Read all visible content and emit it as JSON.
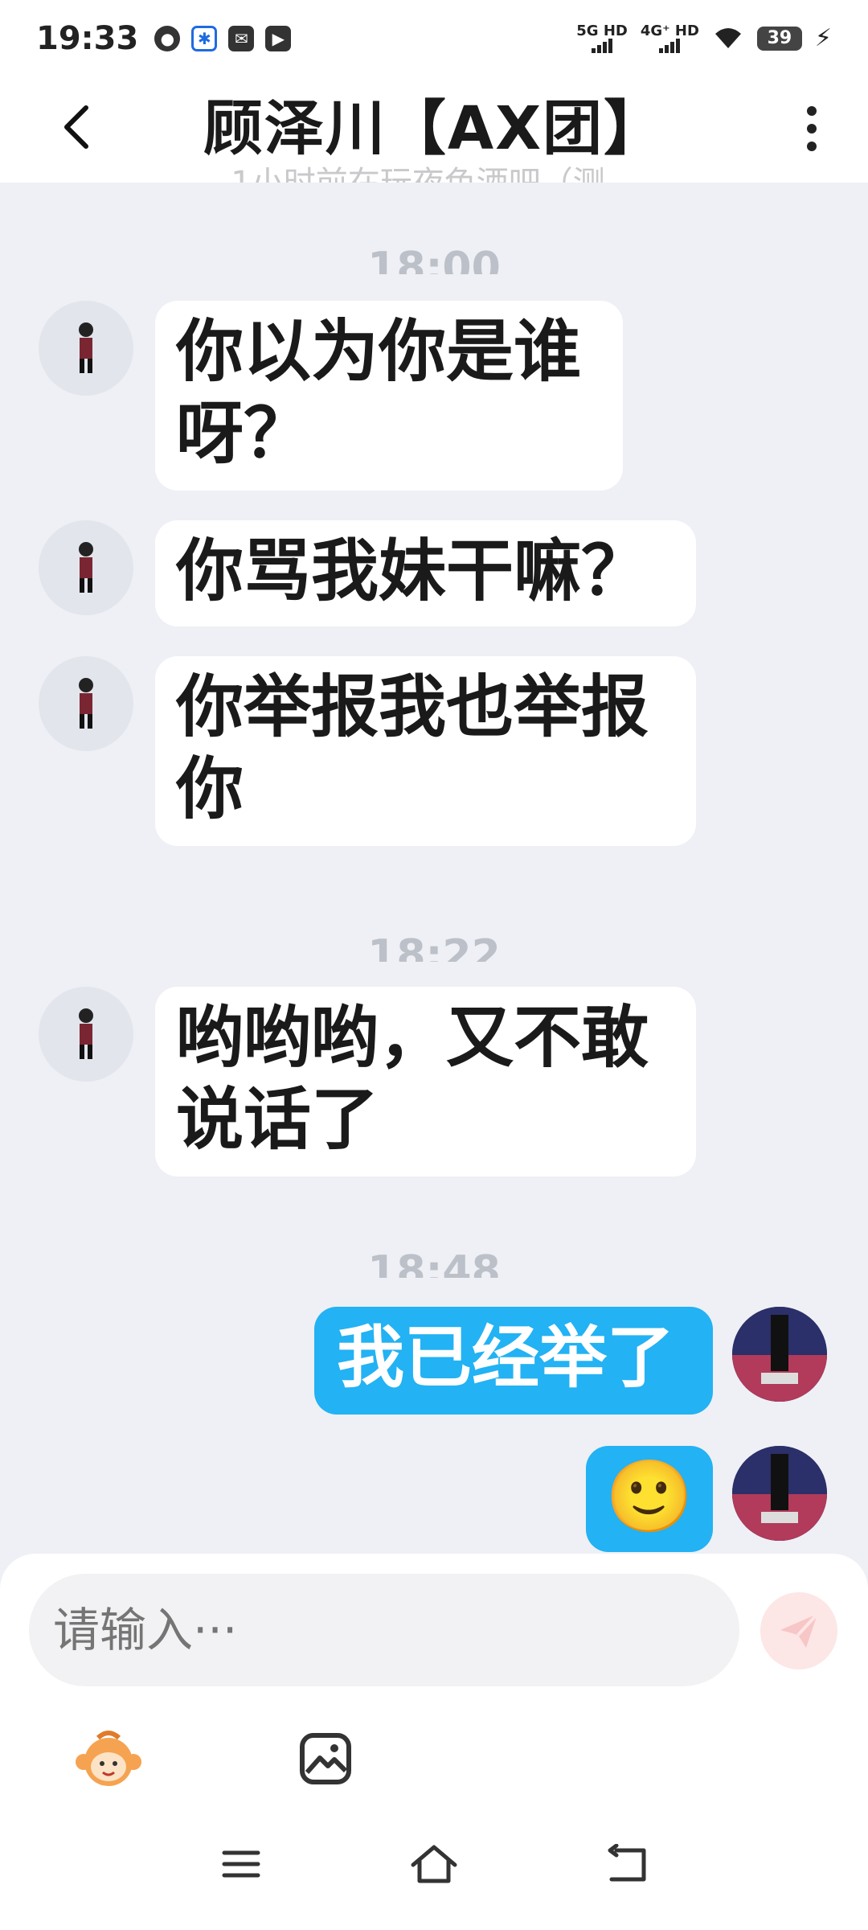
{
  "status_bar": {
    "time": "19:33",
    "net1": "5G HD",
    "net2": "4G⁺ HD",
    "battery": "39"
  },
  "header": {
    "title": "顾泽川【AX团】",
    "subtitle": "1小时前在玩夜色酒吧（测…"
  },
  "chat": {
    "separators": [
      "18:00",
      "18:22",
      "18:48"
    ],
    "messages": [
      {
        "from": "other",
        "text": "你以为你是谁\n呀？"
      },
      {
        "from": "other",
        "text": "你骂我妹干嘛？"
      },
      {
        "from": "other",
        "text": "你举报我也举报\n你"
      },
      {
        "from": "other",
        "text": "哟哟哟，又不敢\n说话了"
      },
      {
        "from": "me",
        "text": "我已经举了"
      },
      {
        "from": "me",
        "text": "🙂"
      }
    ]
  },
  "composer": {
    "placeholder": "请输入···"
  },
  "icons": {
    "back": "chevron-left-icon",
    "more": "more-vertical-icon",
    "send": "send-icon",
    "sticker": "monkey-sticker-icon",
    "image": "image-icon",
    "menu": "menu-icon",
    "home": "home-icon",
    "back_nav": "back-arrow-icon"
  },
  "colors": {
    "bubble_me": "#23b2f3",
    "bubble_other": "#ffffff",
    "background": "#eef0f5",
    "send_disabled": "#fde6e6"
  }
}
